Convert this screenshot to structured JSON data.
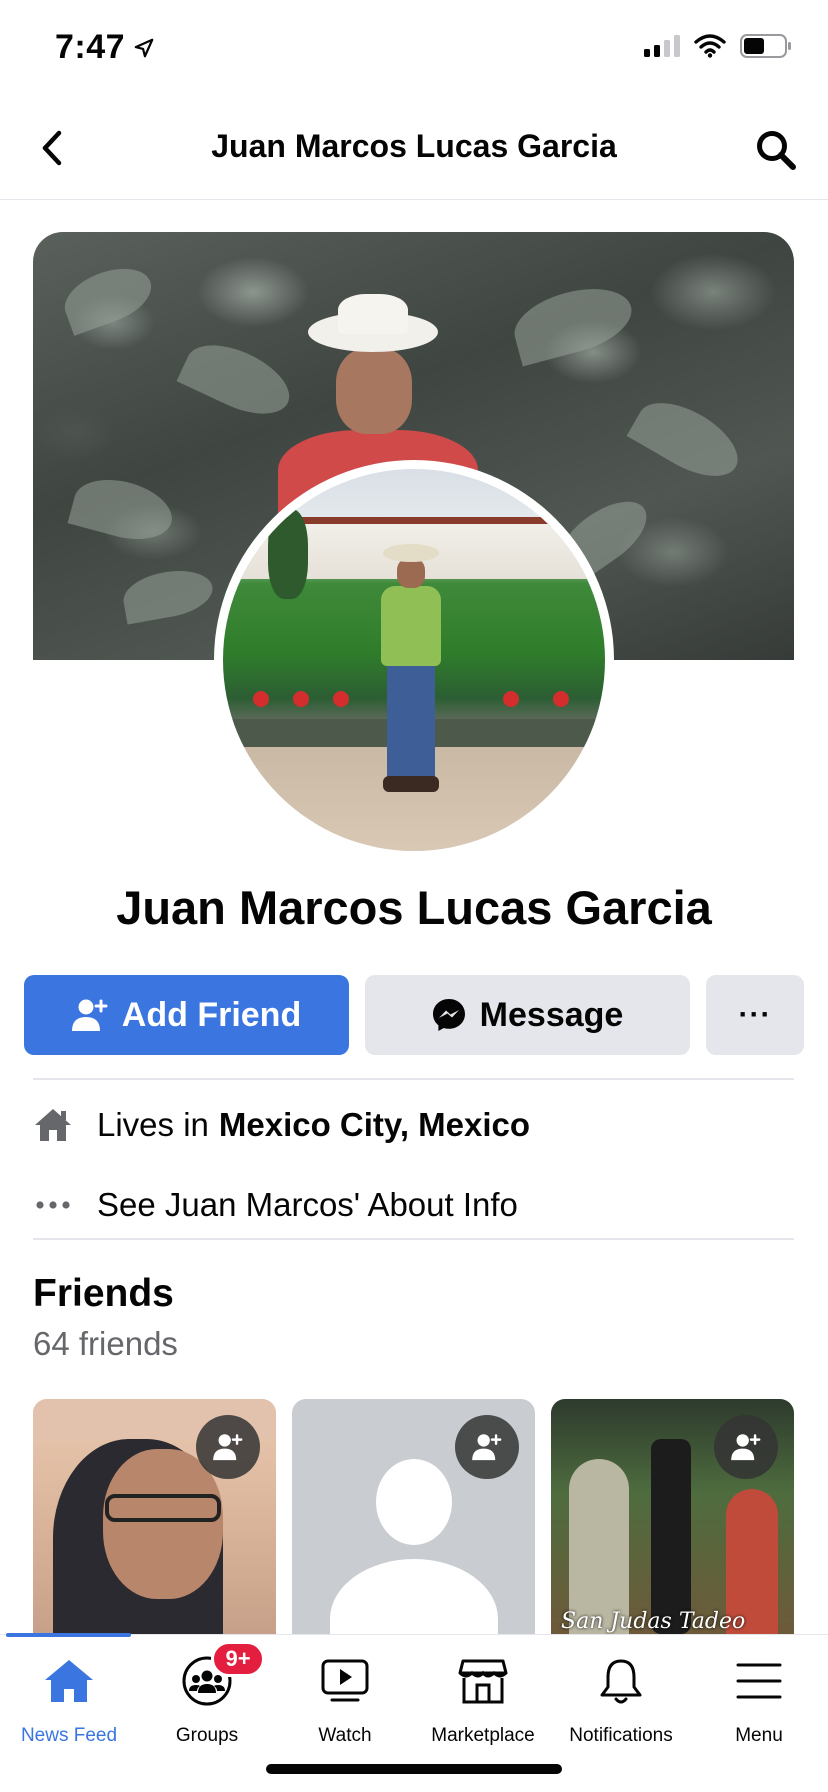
{
  "status_bar": {
    "time": "7:47",
    "icons": [
      "location-arrow-icon",
      "cellular-signal-icon",
      "wifi-icon",
      "battery-icon"
    ]
  },
  "nav": {
    "title": "Juan Marcos Lucas Garcia",
    "back_icon": "chevron-left-icon",
    "search_icon": "search-icon"
  },
  "profile": {
    "name": "Juan Marcos Lucas Garcia"
  },
  "actions": {
    "add_friend_label": "Add Friend",
    "message_label": "Message",
    "more_label": "···"
  },
  "about": {
    "lives_prefix": "Lives in",
    "lives_place": "Mexico City, Mexico",
    "see_about_label": "See Juan Marcos' About Info"
  },
  "friends": {
    "title": "Friends",
    "count_label": "64 friends",
    "cards": [
      {
        "caption": ""
      },
      {
        "caption": ""
      },
      {
        "caption": "San Judas Tadeo"
      }
    ]
  },
  "tabbar": {
    "tabs": [
      {
        "label": "News Feed",
        "icon": "home-icon",
        "active": true
      },
      {
        "label": "Groups",
        "icon": "groups-icon",
        "badge": "9+"
      },
      {
        "label": "Watch",
        "icon": "watch-icon"
      },
      {
        "label": "Marketplace",
        "icon": "marketplace-icon"
      },
      {
        "label": "Notifications",
        "icon": "bell-icon"
      },
      {
        "label": "Menu",
        "icon": "hamburger-menu-icon"
      }
    ]
  },
  "colors": {
    "accent": "#3a75e0",
    "badge": "#e41e3f",
    "secondary_button": "#e4e6eb",
    "secondary_text": "#65676b"
  }
}
